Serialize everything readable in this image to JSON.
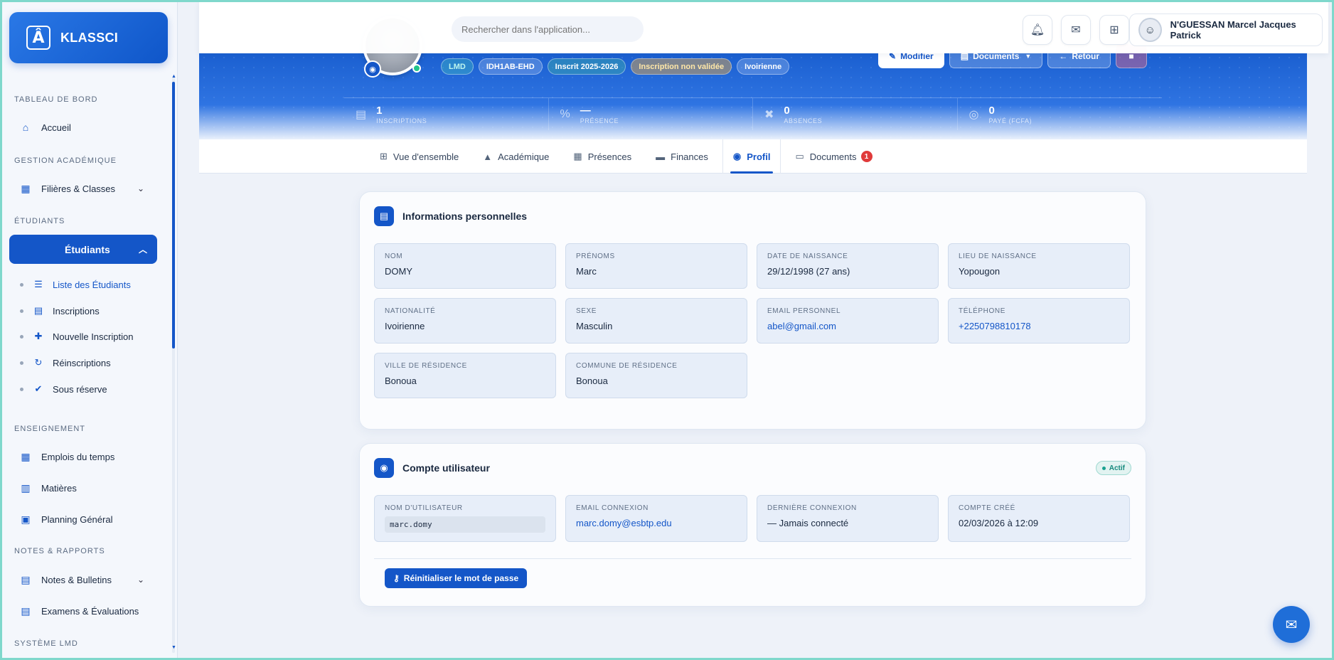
{
  "brand": {
    "name": "KLASSCI",
    "logo_letter": "Â"
  },
  "sidebar": {
    "sections": [
      {
        "title": "TABLEAU DE BORD",
        "items": [
          {
            "label": "Accueil",
            "icon": "home-icon"
          }
        ]
      },
      {
        "title": "GESTION ACADÉMIQUE",
        "items": [
          {
            "label": "Filières & Classes",
            "icon": "building-icon"
          }
        ]
      },
      {
        "title": "ÉTUDIANTS"
      },
      {
        "title": "ENSEIGNEMENT",
        "items": [
          {
            "label": "Emplois du temps",
            "icon": "calendar-icon"
          },
          {
            "label": "Matières",
            "icon": "book-icon"
          },
          {
            "label": "Planning Général",
            "icon": "calendar-check-icon"
          }
        ]
      },
      {
        "title": "NOTES & RAPPORTS",
        "items": [
          {
            "label": "Notes & Bulletins",
            "icon": "file-icon"
          },
          {
            "label": "Examens & Évaluations",
            "icon": "clipboard-icon"
          }
        ]
      },
      {
        "title": "SYSTÈME LMD"
      }
    ],
    "active_group": "Étudiants",
    "sub_items": [
      {
        "label": "Liste des Étudiants",
        "icon": "list-icon",
        "active": true
      },
      {
        "label": "Inscriptions",
        "icon": "clipboard-icon"
      },
      {
        "label": "Nouvelle Inscription",
        "icon": "user-plus-icon"
      },
      {
        "label": "Réinscriptions",
        "icon": "refresh-icon"
      },
      {
        "label": "Sous réserve",
        "icon": "clipboard-check-icon"
      }
    ]
  },
  "topbar": {
    "search_placeholder": "Rechercher dans l'application...",
    "user_name": "N'GUESSAN Marcel Jacques Patrick"
  },
  "hero": {
    "badges": [
      "LMD",
      "IDH1AB-EHD",
      "Inscrit 2025-2026",
      "Inscription non validée",
      "Ivoirienne"
    ],
    "actions": {
      "edit": "Modifier",
      "documents": "Documents",
      "back": "Retour"
    },
    "stats": [
      {
        "value": "1",
        "label": "INSCRIPTIONS"
      },
      {
        "value": "—",
        "label": "PRÉSENCE"
      },
      {
        "value": "0",
        "label": "ABSENCES"
      },
      {
        "value": "0",
        "label": "PAYÉ (FCFA)"
      }
    ]
  },
  "tabs": [
    {
      "label": "Vue d'ensemble",
      "icon": "table-icon"
    },
    {
      "label": "Académique",
      "icon": "graduation-cap-icon"
    },
    {
      "label": "Présences",
      "icon": "calendar-icon"
    },
    {
      "label": "Finances",
      "icon": "finance-icon"
    },
    {
      "label": "Profil",
      "icon": "user-circle-icon",
      "active": true
    },
    {
      "label": "Documents",
      "icon": "folder-icon",
      "count": "1"
    }
  ],
  "personal": {
    "title": "Informations personnelles",
    "fields": [
      {
        "label": "NOM",
        "value": "DOMY"
      },
      {
        "label": "PRÉNOMS",
        "value": "Marc"
      },
      {
        "label": "DATE DE NAISSANCE",
        "value": "29/12/1998 (27 ans)"
      },
      {
        "label": "LIEU DE NAISSANCE",
        "value": "Yopougon"
      },
      {
        "label": "NATIONALITÉ",
        "value": "Ivoirienne"
      },
      {
        "label": "SEXE",
        "value": "Masculin"
      },
      {
        "label": "EMAIL PERSONNEL",
        "value": "abel@gmail.com"
      },
      {
        "label": "TÉLÉPHONE",
        "value": "+2250798810178"
      },
      {
        "label": "VILLE DE RÉSIDENCE",
        "value": "Bonoua"
      },
      {
        "label": "COMMUNE DE RÉSIDENCE",
        "value": "Bonoua"
      }
    ]
  },
  "account": {
    "title": "Compte utilisateur",
    "status": "Actif",
    "fields": [
      {
        "label": "NOM D'UTILISATEUR",
        "value": "marc.domy"
      },
      {
        "label": "EMAIL CONNEXION",
        "value": "marc.domy@esbtp.edu"
      },
      {
        "label": "DERNIÈRE CONNEXION",
        "value": "— Jamais connecté"
      },
      {
        "label": "COMPTE CRÉÉ",
        "value": "02/03/2026 à 12:09"
      }
    ],
    "reset_label": "Réinitialiser le mot de passe"
  },
  "colors": {
    "primary": "#1456c8",
    "accent_teal": "#7fd8cc",
    "badge_red": "#e03a3a"
  }
}
